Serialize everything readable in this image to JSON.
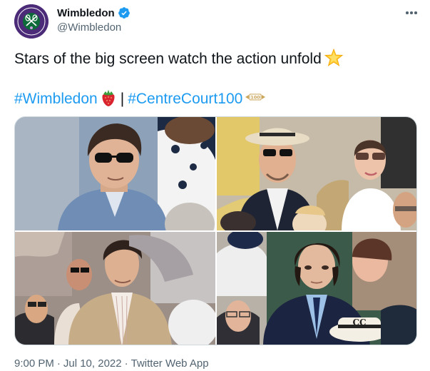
{
  "account": {
    "display_name": "Wimbledon",
    "handle": "@Wimbledon",
    "verified": true,
    "avatar_icon": "wimbledon-logo",
    "brand_color": "#4b2a78",
    "verified_color": "#1d9bf0"
  },
  "tweet": {
    "text": "Stars of the big screen watch the action unfold",
    "text_emoji": "star-emoji",
    "hashtags": [
      "#Wimbledon",
      "#CentreCourt100"
    ],
    "separator": "|",
    "hashtag_color": "#1d9bf0"
  },
  "media": {
    "photos": [
      {
        "icon": "photo-sunglasses-man"
      },
      {
        "icon": "photo-panama-hat-man"
      },
      {
        "icon": "photo-beige-suit-man"
      },
      {
        "icon": "photo-navy-suit-man"
      }
    ]
  },
  "footer": {
    "time": "9:00 PM",
    "date": "Jul 10, 2022",
    "separator": "·",
    "source": "Twitter Web App"
  }
}
